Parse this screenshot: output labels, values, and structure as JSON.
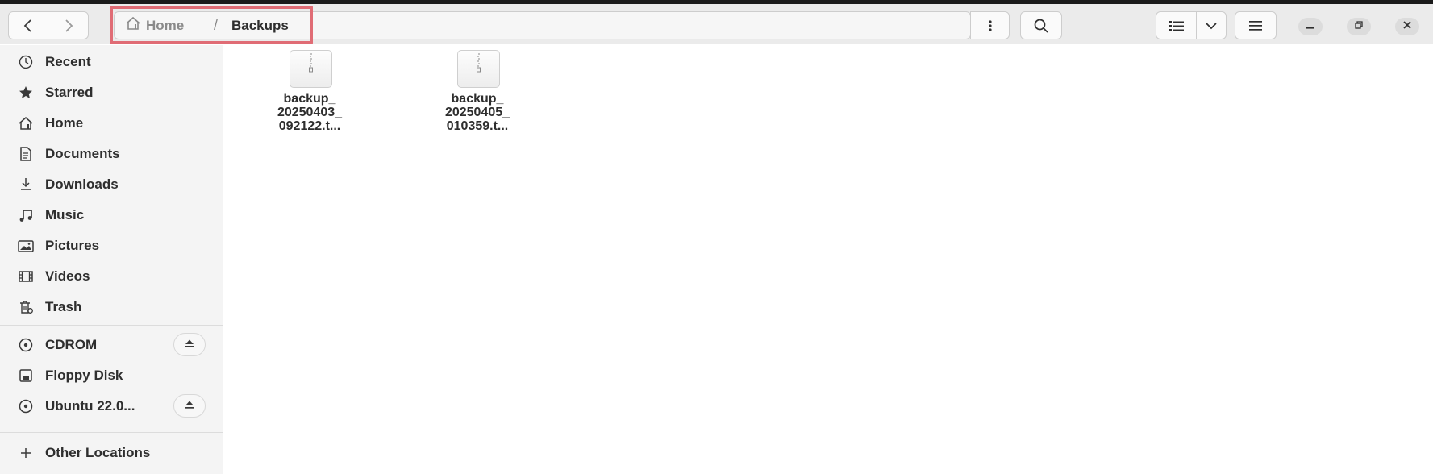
{
  "header": {
    "back_icon": "go-back-icon",
    "forward_icon": "go-forward-icon",
    "path": [
      {
        "label": "Home",
        "icon": "home-icon"
      },
      {
        "label": "Backups"
      }
    ],
    "path_separator": "/",
    "path_menu_icon": "vertical-dots-icon",
    "search_icon": "search-icon",
    "view_icon": "list-view-icon",
    "view_dropdown_icon": "chevron-down-icon",
    "menu_icon": "hamburger-menu-icon",
    "window_controls": [
      "minimize-icon",
      "maximize-icon",
      "close-icon"
    ],
    "highlight_color": "#e06c75"
  },
  "sidebar": {
    "places": [
      {
        "label": "Recent",
        "icon": "clock-icon"
      },
      {
        "label": "Starred",
        "icon": "star-icon"
      },
      {
        "label": "Home",
        "icon": "home-icon"
      },
      {
        "label": "Documents",
        "icon": "document-icon"
      },
      {
        "label": "Downloads",
        "icon": "download-icon"
      },
      {
        "label": "Music",
        "icon": "music-note-icon"
      },
      {
        "label": "Pictures",
        "icon": "picture-icon"
      },
      {
        "label": "Videos",
        "icon": "film-icon"
      },
      {
        "label": "Trash",
        "icon": "trash-icon"
      }
    ],
    "devices": [
      {
        "label": "CDROM",
        "icon": "disc-icon",
        "eject": true
      },
      {
        "label": "Floppy Disk",
        "icon": "floppy-icon",
        "eject": false
      },
      {
        "label": "Ubuntu 22.0...",
        "icon": "disc-icon",
        "eject": true
      }
    ],
    "other_locations": {
      "label": "Other Locations",
      "icon": "plus-icon"
    }
  },
  "files": [
    {
      "name_lines": [
        "backup_",
        "20250403_",
        "092122.t..."
      ],
      "icon": "archive-file-icon"
    },
    {
      "name_lines": [
        "backup_",
        "20250405_",
        "010359.t..."
      ],
      "icon": "archive-file-icon"
    }
  ]
}
